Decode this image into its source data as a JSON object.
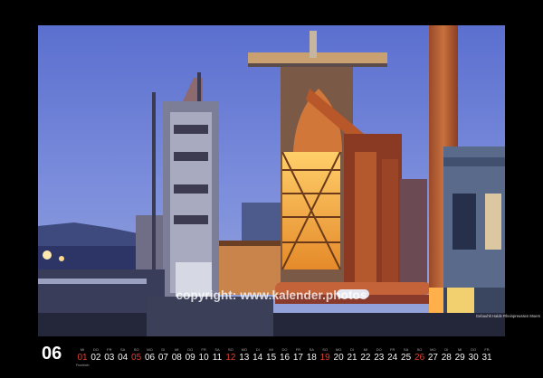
{
  "photo": {
    "copyright": "copyright: www.kalender.photos",
    "caption": "Gebauhlt Halde Rheinpreussen Moers"
  },
  "calendar": {
    "month_number": "06",
    "sunday_color": "#e04032",
    "days": [
      {
        "wd": "MI",
        "num": "01",
        "sun": true,
        "note": "Fronleich"
      },
      {
        "wd": "DO",
        "num": "02",
        "sun": false,
        "note": ""
      },
      {
        "wd": "FR",
        "num": "03",
        "sun": false,
        "note": ""
      },
      {
        "wd": "SA",
        "num": "04",
        "sun": false,
        "note": ""
      },
      {
        "wd": "SO",
        "num": "05",
        "sun": true,
        "note": ""
      },
      {
        "wd": "MO",
        "num": "06",
        "sun": false,
        "note": ""
      },
      {
        "wd": "DI",
        "num": "07",
        "sun": false,
        "note": ""
      },
      {
        "wd": "MI",
        "num": "08",
        "sun": false,
        "note": ""
      },
      {
        "wd": "DO",
        "num": "09",
        "sun": false,
        "note": ""
      },
      {
        "wd": "FR",
        "num": "10",
        "sun": false,
        "note": ""
      },
      {
        "wd": "SA",
        "num": "11",
        "sun": false,
        "note": ""
      },
      {
        "wd": "SO",
        "num": "12",
        "sun": true,
        "note": ""
      },
      {
        "wd": "MO",
        "num": "13",
        "sun": false,
        "note": ""
      },
      {
        "wd": "DI",
        "num": "14",
        "sun": false,
        "note": ""
      },
      {
        "wd": "MI",
        "num": "15",
        "sun": false,
        "note": ""
      },
      {
        "wd": "DO",
        "num": "16",
        "sun": false,
        "note": ""
      },
      {
        "wd": "FR",
        "num": "17",
        "sun": false,
        "note": ""
      },
      {
        "wd": "SA",
        "num": "18",
        "sun": false,
        "note": ""
      },
      {
        "wd": "SO",
        "num": "19",
        "sun": true,
        "note": ""
      },
      {
        "wd": "MO",
        "num": "20",
        "sun": false,
        "note": ""
      },
      {
        "wd": "DI",
        "num": "21",
        "sun": false,
        "note": ""
      },
      {
        "wd": "MI",
        "num": "22",
        "sun": false,
        "note": ""
      },
      {
        "wd": "DO",
        "num": "23",
        "sun": false,
        "note": ""
      },
      {
        "wd": "FR",
        "num": "24",
        "sun": false,
        "note": ""
      },
      {
        "wd": "SA",
        "num": "25",
        "sun": false,
        "note": ""
      },
      {
        "wd": "SO",
        "num": "26",
        "sun": true,
        "note": ""
      },
      {
        "wd": "MO",
        "num": "27",
        "sun": false,
        "note": ""
      },
      {
        "wd": "DI",
        "num": "28",
        "sun": false,
        "note": ""
      },
      {
        "wd": "MI",
        "num": "29",
        "sun": false,
        "note": ""
      },
      {
        "wd": "DO",
        "num": "30",
        "sun": false,
        "note": ""
      },
      {
        "wd": "FR",
        "num": "31",
        "sun": false,
        "note": ""
      }
    ]
  }
}
